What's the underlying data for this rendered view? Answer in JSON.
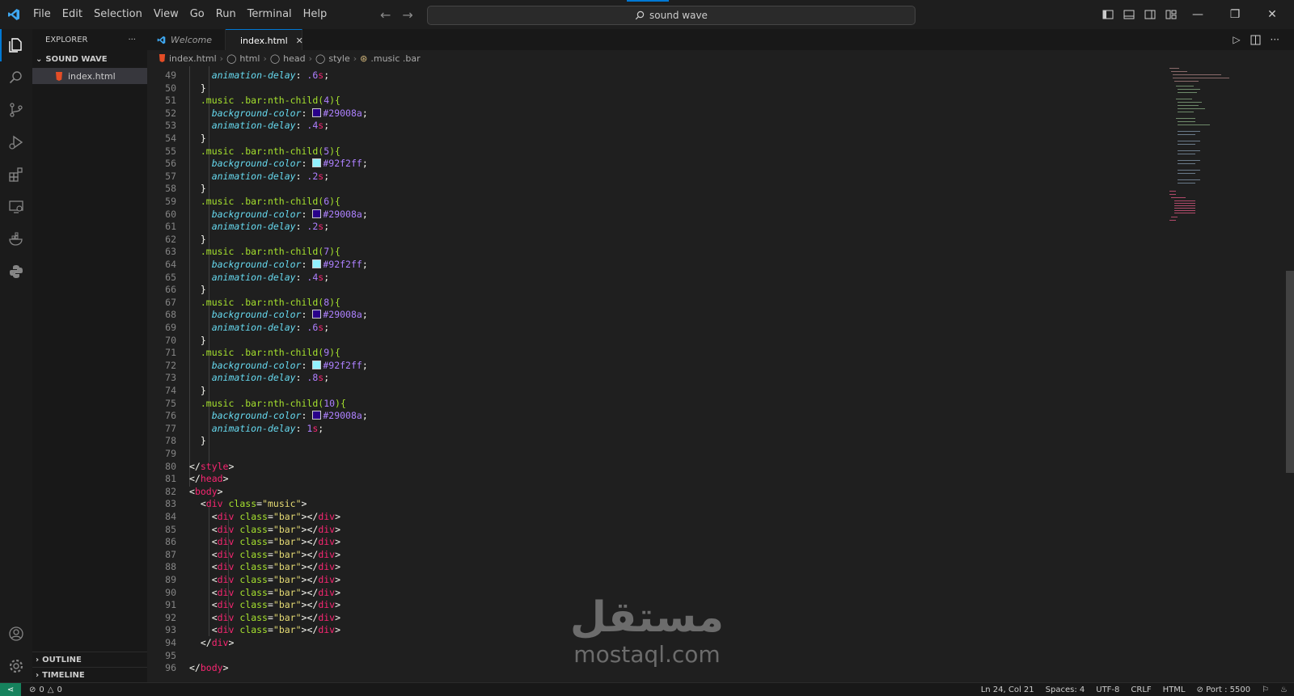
{
  "menu": [
    "File",
    "Edit",
    "Selection",
    "View",
    "Go",
    "Run",
    "Terminal",
    "Help"
  ],
  "search": {
    "text": "sound wave"
  },
  "explorer": {
    "title": "EXPLORER",
    "more": "···",
    "folder": "SOUND WAVE",
    "file": "index.html",
    "outline": "OUTLINE",
    "timeline": "TIMELINE"
  },
  "tabs": [
    {
      "label": "Welcome"
    },
    {
      "label": "index.html"
    }
  ],
  "breadcrumb": [
    "index.html",
    "html",
    "head",
    "style",
    ".music .bar"
  ],
  "colors": {
    "accent": "#0078d4",
    "purple": "#29008a",
    "cyan": "#92f2ff"
  },
  "code": [
    {
      "n": "49",
      "t": [
        [
          "    ",
          ""
        ],
        [
          "animation-delay",
          "prop"
        ],
        [
          ": ",
          "p"
        ],
        [
          ".6",
          "num"
        ],
        [
          "s",
          "unit"
        ],
        [
          ";",
          "p"
        ]
      ]
    },
    {
      "n": "50",
      "t": [
        [
          "  }",
          "p"
        ]
      ]
    },
    {
      "n": "51",
      "t": [
        [
          "  ",
          ""
        ],
        [
          ".music .bar:nth-child(",
          "sel"
        ],
        [
          "4",
          "num"
        ],
        [
          "){",
          "sel"
        ]
      ]
    },
    {
      "n": "52",
      "t": [
        [
          "    ",
          ""
        ],
        [
          "background-color",
          "prop"
        ],
        [
          ": ",
          "p"
        ],
        [
          "SWATCH:#29008a",
          ""
        ],
        [
          "#29008a",
          "num"
        ],
        [
          ";",
          "p"
        ]
      ]
    },
    {
      "n": "53",
      "t": [
        [
          "    ",
          ""
        ],
        [
          "animation-delay",
          "prop"
        ],
        [
          ": ",
          "p"
        ],
        [
          ".4",
          "num"
        ],
        [
          "s",
          "unit"
        ],
        [
          ";",
          "p"
        ]
      ]
    },
    {
      "n": "54",
      "t": [
        [
          "  }",
          "p"
        ]
      ]
    },
    {
      "n": "55",
      "t": [
        [
          "  ",
          ""
        ],
        [
          ".music .bar:nth-child(",
          "sel"
        ],
        [
          "5",
          "num"
        ],
        [
          "){",
          "sel"
        ]
      ]
    },
    {
      "n": "56",
      "t": [
        [
          "    ",
          ""
        ],
        [
          "background-color",
          "prop"
        ],
        [
          ": ",
          "p"
        ],
        [
          "SWATCH:#92f2ff",
          ""
        ],
        [
          "#92f2ff",
          "num"
        ],
        [
          ";",
          "p"
        ]
      ]
    },
    {
      "n": "57",
      "t": [
        [
          "    ",
          ""
        ],
        [
          "animation-delay",
          "prop"
        ],
        [
          ": ",
          "p"
        ],
        [
          ".2",
          "num"
        ],
        [
          "s",
          "unit"
        ],
        [
          ";",
          "p"
        ]
      ]
    },
    {
      "n": "58",
      "t": [
        [
          "  }",
          "p"
        ]
      ]
    },
    {
      "n": "59",
      "t": [
        [
          "  ",
          ""
        ],
        [
          ".music .bar:nth-child(",
          "sel"
        ],
        [
          "6",
          "num"
        ],
        [
          "){",
          "sel"
        ]
      ]
    },
    {
      "n": "60",
      "t": [
        [
          "    ",
          ""
        ],
        [
          "background-color",
          "prop"
        ],
        [
          ": ",
          "p"
        ],
        [
          "SWATCH:#29008a",
          ""
        ],
        [
          "#29008a",
          "num"
        ],
        [
          ";",
          "p"
        ]
      ]
    },
    {
      "n": "61",
      "t": [
        [
          "    ",
          ""
        ],
        [
          "animation-delay",
          "prop"
        ],
        [
          ": ",
          "p"
        ],
        [
          ".2",
          "num"
        ],
        [
          "s",
          "unit"
        ],
        [
          ";",
          "p"
        ]
      ]
    },
    {
      "n": "62",
      "t": [
        [
          "  }",
          "p"
        ]
      ]
    },
    {
      "n": "63",
      "t": [
        [
          "  ",
          ""
        ],
        [
          ".music .bar:nth-child(",
          "sel"
        ],
        [
          "7",
          "num"
        ],
        [
          "){",
          "sel"
        ]
      ]
    },
    {
      "n": "64",
      "t": [
        [
          "    ",
          ""
        ],
        [
          "background-color",
          "prop"
        ],
        [
          ": ",
          "p"
        ],
        [
          "SWATCH:#92f2ff",
          ""
        ],
        [
          "#92f2ff",
          "num"
        ],
        [
          ";",
          "p"
        ]
      ]
    },
    {
      "n": "65",
      "t": [
        [
          "    ",
          ""
        ],
        [
          "animation-delay",
          "prop"
        ],
        [
          ": ",
          "p"
        ],
        [
          ".4",
          "num"
        ],
        [
          "s",
          "unit"
        ],
        [
          ";",
          "p"
        ]
      ]
    },
    {
      "n": "66",
      "t": [
        [
          "  }",
          "p"
        ]
      ]
    },
    {
      "n": "67",
      "t": [
        [
          "  ",
          ""
        ],
        [
          ".music .bar:nth-child(",
          "sel"
        ],
        [
          "8",
          "num"
        ],
        [
          "){",
          "sel"
        ]
      ]
    },
    {
      "n": "68",
      "t": [
        [
          "    ",
          ""
        ],
        [
          "background-color",
          "prop"
        ],
        [
          ": ",
          "p"
        ],
        [
          "SWATCH:#29008a",
          ""
        ],
        [
          "#29008a",
          "num"
        ],
        [
          ";",
          "p"
        ]
      ]
    },
    {
      "n": "69",
      "t": [
        [
          "    ",
          ""
        ],
        [
          "animation-delay",
          "prop"
        ],
        [
          ": ",
          "p"
        ],
        [
          ".6",
          "num"
        ],
        [
          "s",
          "unit"
        ],
        [
          ";",
          "p"
        ]
      ]
    },
    {
      "n": "70",
      "t": [
        [
          "  }",
          "p"
        ]
      ]
    },
    {
      "n": "71",
      "t": [
        [
          "  ",
          ""
        ],
        [
          ".music .bar:nth-child(",
          "sel"
        ],
        [
          "9",
          "num"
        ],
        [
          "){",
          "sel"
        ]
      ]
    },
    {
      "n": "72",
      "t": [
        [
          "    ",
          ""
        ],
        [
          "background-color",
          "prop"
        ],
        [
          ": ",
          "p"
        ],
        [
          "SWATCH:#92f2ff",
          ""
        ],
        [
          "#92f2ff",
          "num"
        ],
        [
          ";",
          "p"
        ]
      ]
    },
    {
      "n": "73",
      "t": [
        [
          "    ",
          ""
        ],
        [
          "animation-delay",
          "prop"
        ],
        [
          ": ",
          "p"
        ],
        [
          ".8",
          "num"
        ],
        [
          "s",
          "unit"
        ],
        [
          ";",
          "p"
        ]
      ]
    },
    {
      "n": "74",
      "t": [
        [
          "  }",
          "p"
        ]
      ]
    },
    {
      "n": "75",
      "t": [
        [
          "  ",
          ""
        ],
        [
          ".music .bar:nth-child(",
          "sel"
        ],
        [
          "10",
          "num"
        ],
        [
          "){",
          "sel"
        ]
      ]
    },
    {
      "n": "76",
      "t": [
        [
          "    ",
          ""
        ],
        [
          "background-color",
          "prop"
        ],
        [
          ": ",
          "p"
        ],
        [
          "SWATCH:#29008a",
          ""
        ],
        [
          "#29008a",
          "num"
        ],
        [
          ";",
          "p"
        ]
      ]
    },
    {
      "n": "77",
      "t": [
        [
          "    ",
          ""
        ],
        [
          "animation-delay",
          "prop"
        ],
        [
          ": ",
          "p"
        ],
        [
          "1",
          "num"
        ],
        [
          "s",
          "unit"
        ],
        [
          ";",
          "p"
        ]
      ]
    },
    {
      "n": "78",
      "t": [
        [
          "  }",
          "p"
        ]
      ]
    },
    {
      "n": "79",
      "t": []
    },
    {
      "n": "80",
      "t": [
        [
          "</",
          "p"
        ],
        [
          "style",
          "tag"
        ],
        [
          ">",
          "p"
        ]
      ]
    },
    {
      "n": "81",
      "t": [
        [
          "</",
          "p"
        ],
        [
          "head",
          "tag"
        ],
        [
          ">",
          "p"
        ]
      ]
    },
    {
      "n": "82",
      "t": [
        [
          "<",
          "p"
        ],
        [
          "body",
          "tag"
        ],
        [
          ">",
          "p"
        ]
      ]
    },
    {
      "n": "83",
      "t": [
        [
          "  <",
          "p"
        ],
        [
          "div",
          "tag"
        ],
        [
          " ",
          ""
        ],
        [
          "class",
          "attr"
        ],
        [
          "=",
          "p"
        ],
        [
          "\"music\"",
          "str"
        ],
        [
          ">",
          "p"
        ]
      ]
    },
    {
      "n": "84",
      "t": [
        [
          "    <",
          "p"
        ],
        [
          "div",
          "tag"
        ],
        [
          " ",
          ""
        ],
        [
          "class",
          "attr"
        ],
        [
          "=",
          "p"
        ],
        [
          "\"bar\"",
          "str"
        ],
        [
          "></",
          "p"
        ],
        [
          "div",
          "tag"
        ],
        [
          ">",
          "p"
        ]
      ]
    },
    {
      "n": "85",
      "t": [
        [
          "    <",
          "p"
        ],
        [
          "div",
          "tag"
        ],
        [
          " ",
          ""
        ],
        [
          "class",
          "attr"
        ],
        [
          "=",
          "p"
        ],
        [
          "\"bar\"",
          "str"
        ],
        [
          "></",
          "p"
        ],
        [
          "div",
          "tag"
        ],
        [
          ">",
          "p"
        ]
      ]
    },
    {
      "n": "86",
      "t": [
        [
          "    <",
          "p"
        ],
        [
          "div",
          "tag"
        ],
        [
          " ",
          ""
        ],
        [
          "class",
          "attr"
        ],
        [
          "=",
          "p"
        ],
        [
          "\"bar\"",
          "str"
        ],
        [
          "></",
          "p"
        ],
        [
          "div",
          "tag"
        ],
        [
          ">",
          "p"
        ]
      ]
    },
    {
      "n": "87",
      "t": [
        [
          "    <",
          "p"
        ],
        [
          "div",
          "tag"
        ],
        [
          " ",
          ""
        ],
        [
          "class",
          "attr"
        ],
        [
          "=",
          "p"
        ],
        [
          "\"bar\"",
          "str"
        ],
        [
          "></",
          "p"
        ],
        [
          "div",
          "tag"
        ],
        [
          ">",
          "p"
        ]
      ]
    },
    {
      "n": "88",
      "t": [
        [
          "    <",
          "p"
        ],
        [
          "div",
          "tag"
        ],
        [
          " ",
          ""
        ],
        [
          "class",
          "attr"
        ],
        [
          "=",
          "p"
        ],
        [
          "\"bar\"",
          "str"
        ],
        [
          "></",
          "p"
        ],
        [
          "div",
          "tag"
        ],
        [
          ">",
          "p"
        ]
      ]
    },
    {
      "n": "89",
      "t": [
        [
          "    <",
          "p"
        ],
        [
          "div",
          "tag"
        ],
        [
          " ",
          ""
        ],
        [
          "class",
          "attr"
        ],
        [
          "=",
          "p"
        ],
        [
          "\"bar\"",
          "str"
        ],
        [
          "></",
          "p"
        ],
        [
          "div",
          "tag"
        ],
        [
          ">",
          "p"
        ]
      ]
    },
    {
      "n": "90",
      "t": [
        [
          "    <",
          "p"
        ],
        [
          "div",
          "tag"
        ],
        [
          " ",
          ""
        ],
        [
          "class",
          "attr"
        ],
        [
          "=",
          "p"
        ],
        [
          "\"bar\"",
          "str"
        ],
        [
          "></",
          "p"
        ],
        [
          "div",
          "tag"
        ],
        [
          ">",
          "p"
        ]
      ]
    },
    {
      "n": "91",
      "t": [
        [
          "    <",
          "p"
        ],
        [
          "div",
          "tag"
        ],
        [
          " ",
          ""
        ],
        [
          "class",
          "attr"
        ],
        [
          "=",
          "p"
        ],
        [
          "\"bar\"",
          "str"
        ],
        [
          "></",
          "p"
        ],
        [
          "div",
          "tag"
        ],
        [
          ">",
          "p"
        ]
      ]
    },
    {
      "n": "92",
      "t": [
        [
          "    <",
          "p"
        ],
        [
          "div",
          "tag"
        ],
        [
          " ",
          ""
        ],
        [
          "class",
          "attr"
        ],
        [
          "=",
          "p"
        ],
        [
          "\"bar\"",
          "str"
        ],
        [
          "></",
          "p"
        ],
        [
          "div",
          "tag"
        ],
        [
          ">",
          "p"
        ]
      ]
    },
    {
      "n": "93",
      "t": [
        [
          "    <",
          "p"
        ],
        [
          "div",
          "tag"
        ],
        [
          " ",
          ""
        ],
        [
          "class",
          "attr"
        ],
        [
          "=",
          "p"
        ],
        [
          "\"bar\"",
          "str"
        ],
        [
          "></",
          "p"
        ],
        [
          "div",
          "tag"
        ],
        [
          ">",
          "p"
        ]
      ]
    },
    {
      "n": "94",
      "t": [
        [
          "  </",
          "p"
        ],
        [
          "div",
          "tag"
        ],
        [
          ">",
          "p"
        ]
      ]
    },
    {
      "n": "95",
      "t": []
    },
    {
      "n": "96",
      "t": [
        [
          "</",
          "p"
        ],
        [
          "body",
          "tag"
        ],
        [
          ">",
          "p"
        ]
      ]
    }
  ],
  "watermark": {
    "arabic": "مستقل",
    "latin": "mostaql.com"
  },
  "status": {
    "errors": "0",
    "warnings": "0",
    "position": "Ln 24, Col 21",
    "spaces": "Spaces: 4",
    "encoding": "UTF-8",
    "eol": "CRLF",
    "language": "HTML",
    "port": "Port : 5500"
  }
}
